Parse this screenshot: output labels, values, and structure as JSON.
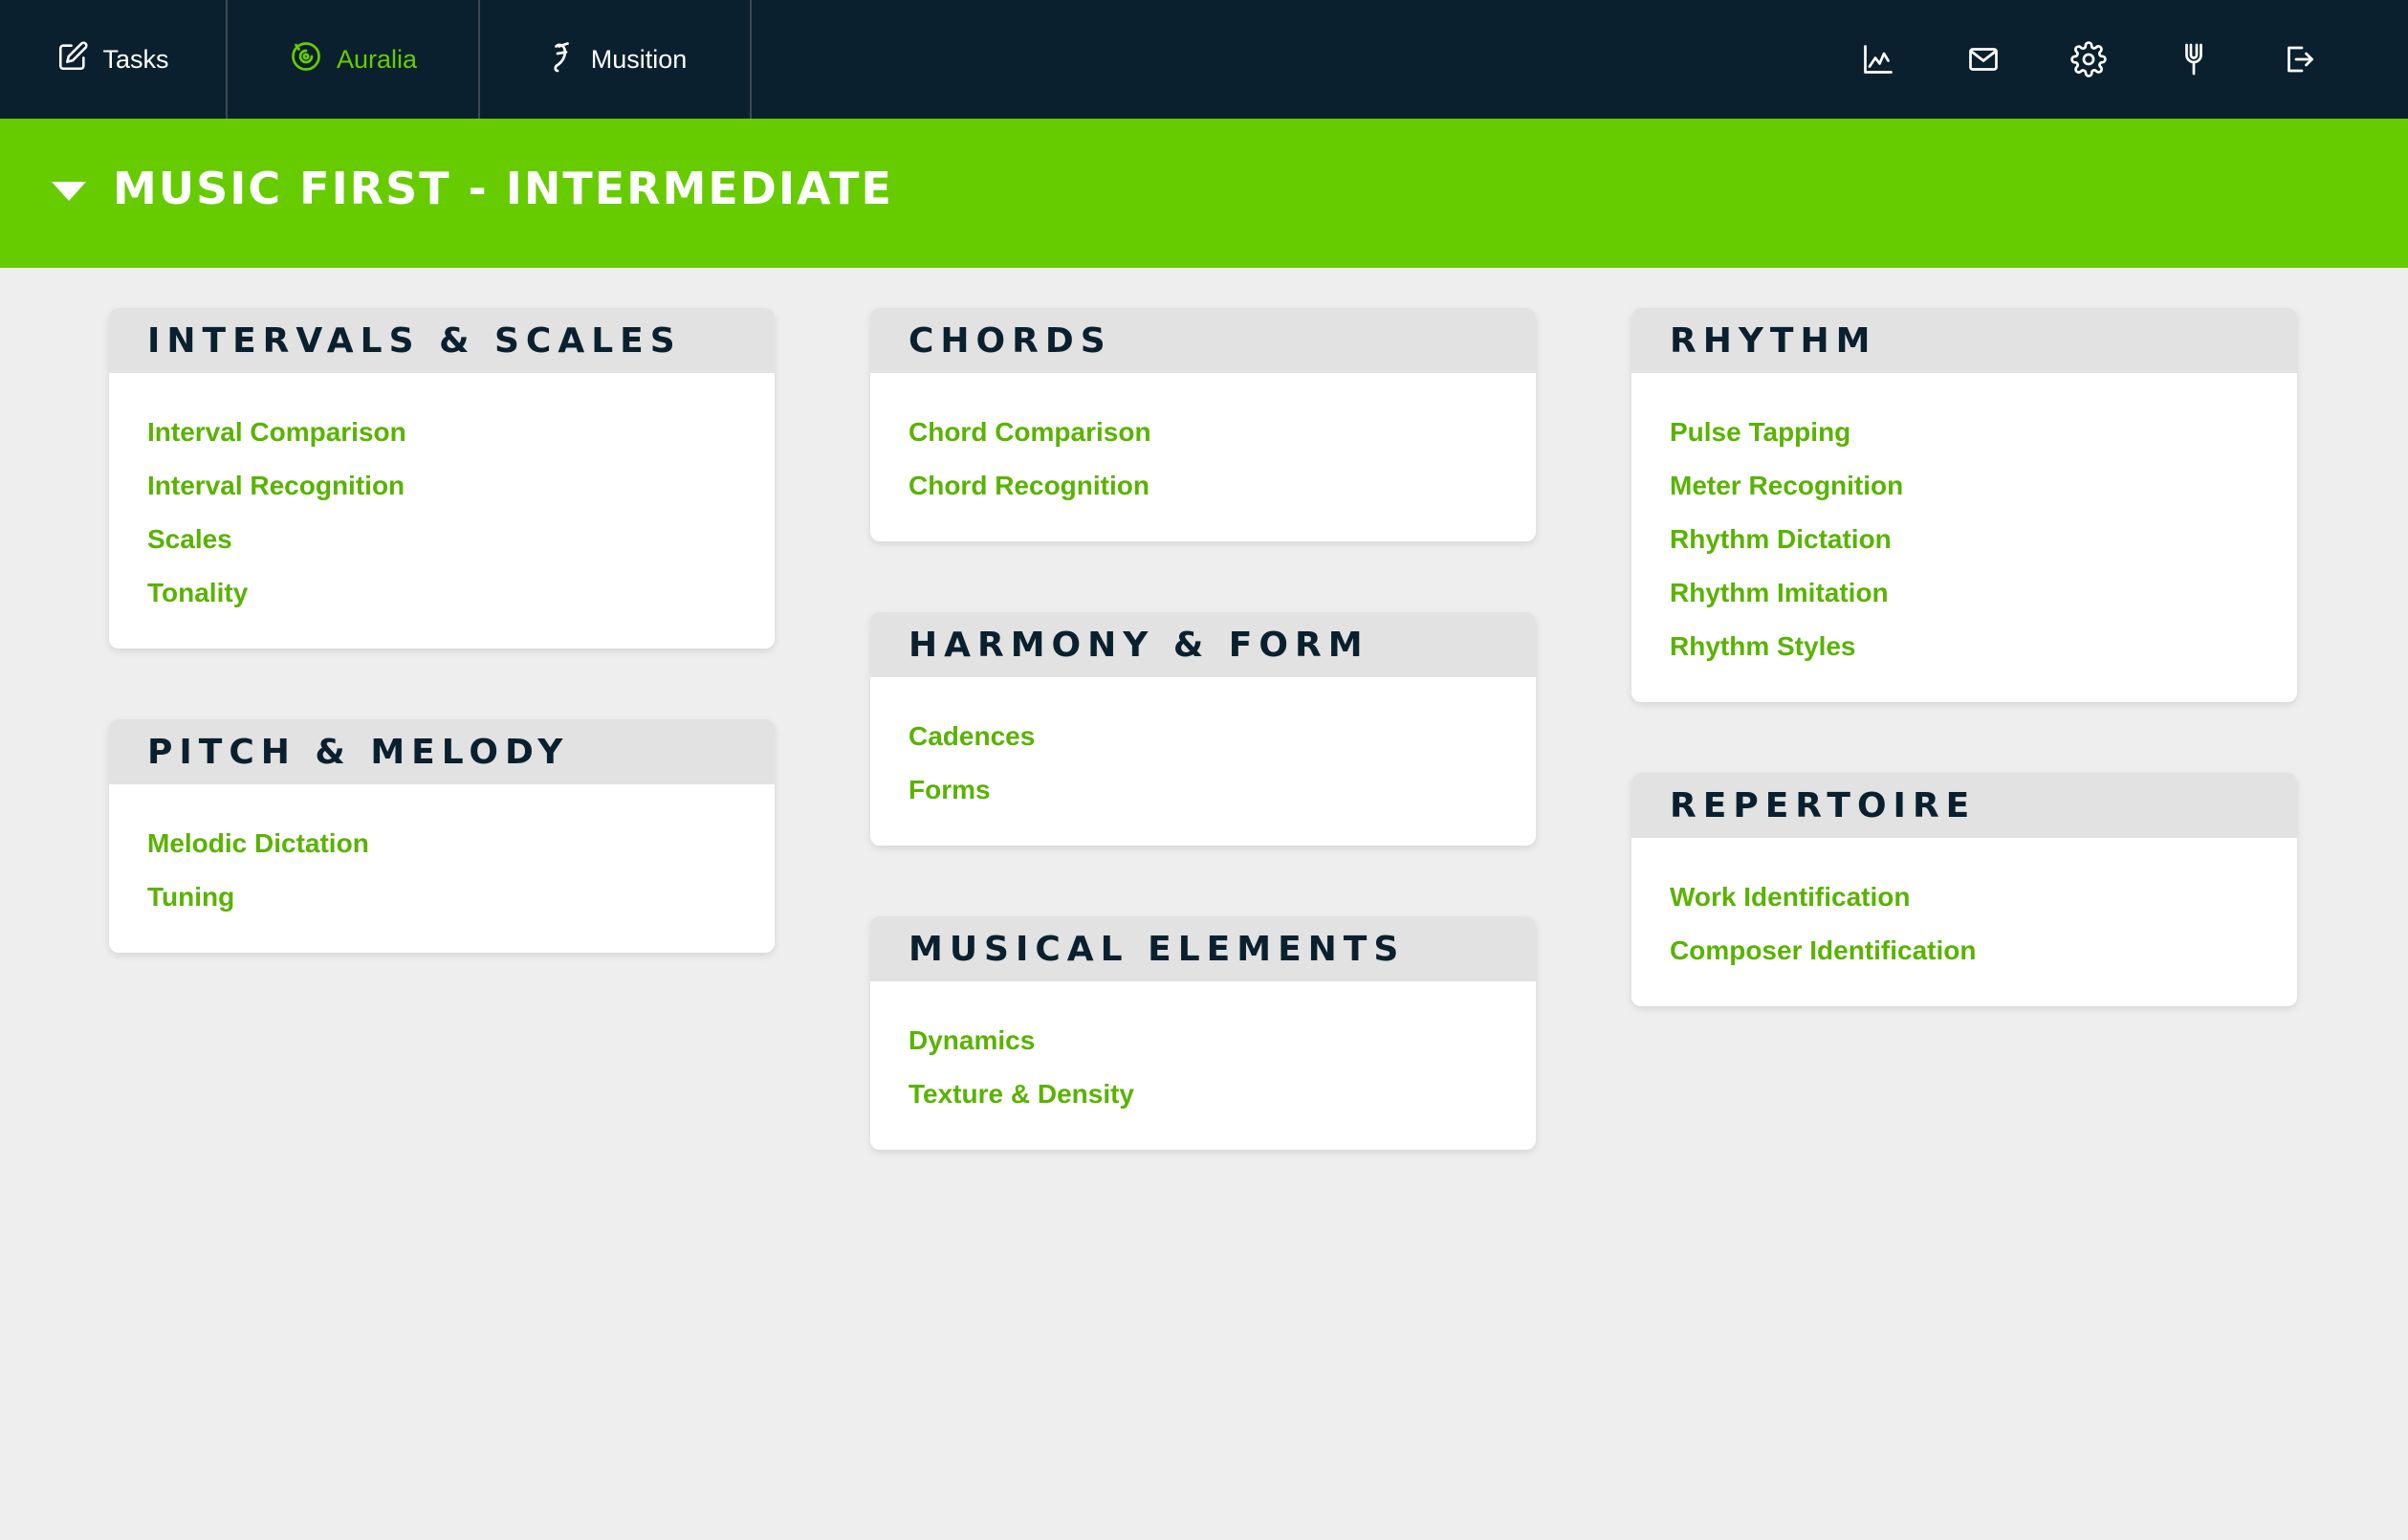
{
  "nav": {
    "tabs": [
      {
        "label": "Tasks",
        "icon": "edit-icon"
      },
      {
        "label": "Auralia",
        "icon": "auralia-logo-icon",
        "active": true
      },
      {
        "label": "Musition",
        "icon": "musition-logo-icon"
      }
    ],
    "tools": [
      "chart-icon",
      "mail-icon",
      "gear-icon",
      "tuning-fork-icon",
      "logout-icon"
    ]
  },
  "banner": {
    "title": "MUSIC FIRST - INTERMEDIATE"
  },
  "colors": {
    "navy": "#0a202e",
    "green": "#66cc00",
    "link": "#59b300",
    "page": "#eeeeee"
  },
  "cards": {
    "intervals": {
      "title": "INTERVALS & SCALES",
      "links": [
        "Interval Comparison",
        "Interval Recognition",
        "Scales",
        "Tonality"
      ]
    },
    "pitch": {
      "title": "PITCH & MELODY",
      "links": [
        "Melodic Dictation",
        "Tuning"
      ]
    },
    "chords": {
      "title": "CHORDS",
      "links": [
        "Chord Comparison",
        "Chord Recognition"
      ]
    },
    "harmony": {
      "title": "HARMONY & FORM",
      "links": [
        "Cadences",
        "Forms"
      ]
    },
    "elements": {
      "title": "MUSICAL ELEMENTS",
      "links": [
        "Dynamics",
        "Texture & Density"
      ]
    },
    "rhythm": {
      "title": "RHYTHM",
      "links": [
        "Pulse Tapping",
        "Meter Recognition",
        "Rhythm Dictation",
        "Rhythm Imitation",
        "Rhythm Styles"
      ]
    },
    "repertoire": {
      "title": "REPERTOIRE",
      "links": [
        "Work Identification",
        "Composer Identification"
      ]
    }
  }
}
